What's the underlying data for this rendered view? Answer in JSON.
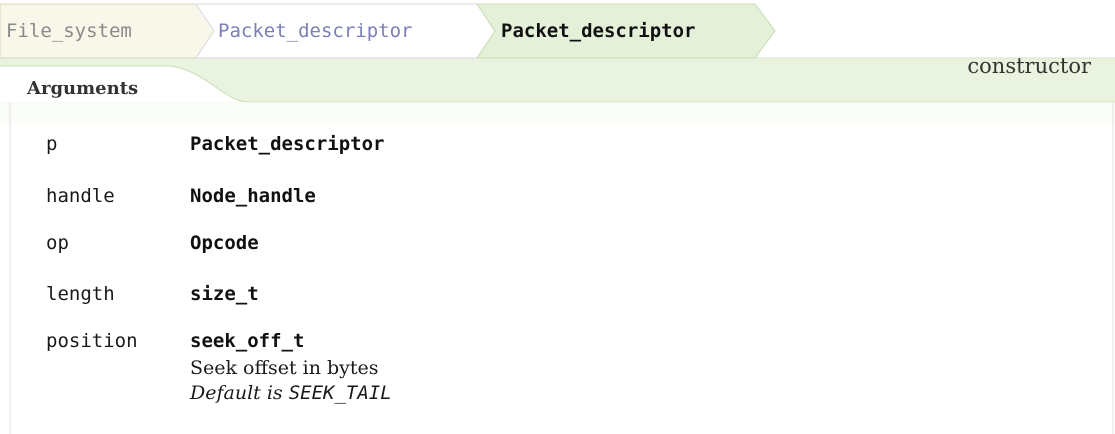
{
  "breadcrumb": {
    "items": [
      "File_system",
      "Packet_descriptor",
      "Packet_descriptor"
    ]
  },
  "kind": "constructor",
  "section_title": "Arguments",
  "arguments": [
    {
      "name": "p",
      "type": "Packet_descriptor"
    },
    {
      "name": "handle",
      "type": "Node_handle"
    },
    {
      "name": "op",
      "type": "Opcode"
    },
    {
      "name": "length",
      "type": "size_t"
    },
    {
      "name": "position",
      "type": "seek_off_t",
      "description": "Seek offset in bytes",
      "default_prefix": "Default is",
      "default_value": "SEEK_TAIL"
    }
  ],
  "colors": {
    "band": "#e9f3df",
    "band_border": "#c8dcb4",
    "root_fill": "#f7f6ea",
    "link": "#7b7fb5",
    "current_fill": "#e2efd4"
  }
}
